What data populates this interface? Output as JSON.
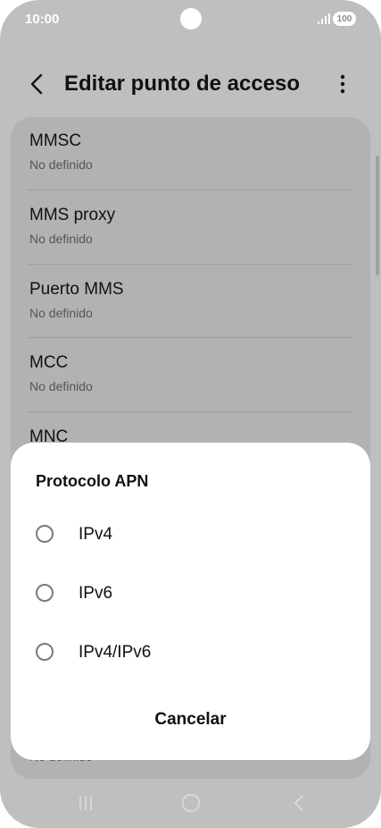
{
  "status": {
    "time": "10:00",
    "battery": "100"
  },
  "header": {
    "title": "Editar punto de acceso"
  },
  "settings": {
    "items": [
      {
        "title": "MMSC",
        "value": "No definido"
      },
      {
        "title": "MMS proxy",
        "value": "No definido"
      },
      {
        "title": "Puerto MMS",
        "value": "No definido"
      },
      {
        "title": "MCC",
        "value": "No definido"
      },
      {
        "title": "MNC",
        "value": ""
      }
    ],
    "peek_value": "No definido"
  },
  "dialog": {
    "title": "Protocolo APN",
    "options": [
      {
        "label": "IPv4",
        "selected": false
      },
      {
        "label": "IPv6",
        "selected": false
      },
      {
        "label": "IPv4/IPv6",
        "selected": false
      }
    ],
    "cancel_label": "Cancelar"
  },
  "colors": {
    "scrim": "#bfbfbf",
    "card": "#b2b2b2",
    "dialog": "#ffffff",
    "text": "#111111"
  }
}
